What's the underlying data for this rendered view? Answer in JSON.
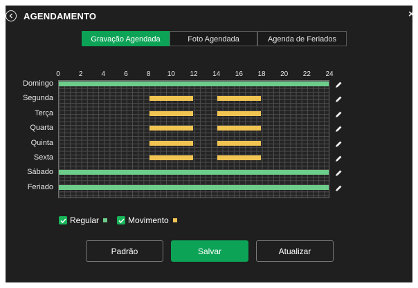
{
  "header": {
    "title": "AGENDAMENTO"
  },
  "tabs": [
    {
      "label": "Gravação Agendada",
      "active": true
    },
    {
      "label": "Foto Agendada",
      "active": false
    },
    {
      "label": "Agenda de Feriados",
      "active": false
    }
  ],
  "schedule": {
    "hour_labels": [
      "0",
      "2",
      "4",
      "6",
      "8",
      "10",
      "12",
      "14",
      "16",
      "18",
      "20",
      "22",
      "24"
    ],
    "days": [
      {
        "label": "Domingo",
        "segments": [
          {
            "type": "regular",
            "start": 0,
            "end": 24
          }
        ]
      },
      {
        "label": "Segunda",
        "segments": [
          {
            "type": "movimento",
            "start": 8,
            "end": 12
          },
          {
            "type": "movimento",
            "start": 14,
            "end": 18
          }
        ]
      },
      {
        "label": "Terça",
        "segments": [
          {
            "type": "movimento",
            "start": 8,
            "end": 12
          },
          {
            "type": "movimento",
            "start": 14,
            "end": 18
          }
        ]
      },
      {
        "label": "Quarta",
        "segments": [
          {
            "type": "movimento",
            "start": 8,
            "end": 12
          },
          {
            "type": "movimento",
            "start": 14,
            "end": 18
          }
        ]
      },
      {
        "label": "Quinta",
        "segments": [
          {
            "type": "movimento",
            "start": 8,
            "end": 12
          },
          {
            "type": "movimento",
            "start": 14,
            "end": 18
          }
        ]
      },
      {
        "label": "Sexta",
        "segments": [
          {
            "type": "movimento",
            "start": 8,
            "end": 12
          },
          {
            "type": "movimento",
            "start": 14,
            "end": 18
          }
        ]
      },
      {
        "label": "Sábado",
        "segments": [
          {
            "type": "regular",
            "start": 0,
            "end": 24
          }
        ]
      },
      {
        "label": "Feriado",
        "segments": [
          {
            "type": "regular",
            "start": 0,
            "end": 24
          }
        ]
      }
    ],
    "edit_icon": "pencil-icon"
  },
  "legend": {
    "regular": {
      "label": "Regular",
      "checked": true,
      "color": "#6dcd8a"
    },
    "movimento": {
      "label": "Movimento",
      "checked": true,
      "color": "#f2c552"
    }
  },
  "buttons": {
    "default_label": "Padrão",
    "save_label": "Salvar",
    "refresh_label": "Atualizar"
  },
  "colors": {
    "accent": "#0da357",
    "background": "#1f1f1f"
  }
}
